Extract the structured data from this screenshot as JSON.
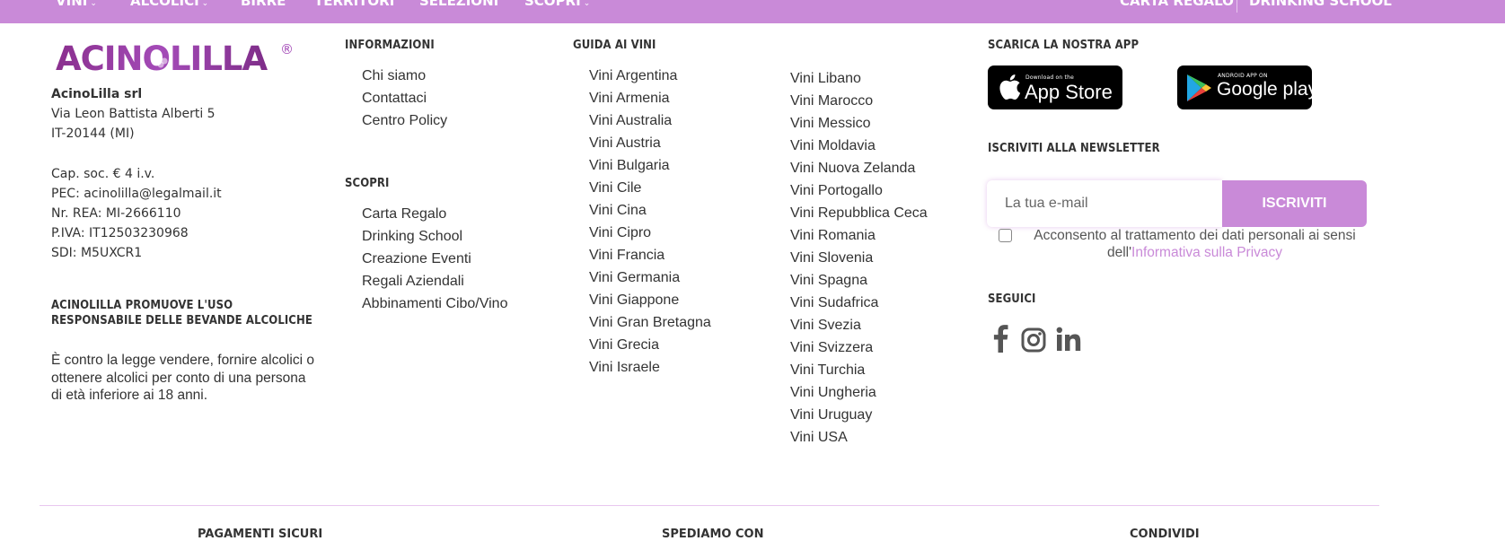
{
  "nav": {
    "left": [
      {
        "label": "VINI",
        "dropdown": true
      },
      {
        "label": "ALCOLICI",
        "dropdown": true
      },
      {
        "label": "BIRRE",
        "dropdown": false
      },
      {
        "label": "TERRITORI",
        "dropdown": false
      },
      {
        "label": "SELEZIONI",
        "dropdown": false
      },
      {
        "label": "SCOPRI",
        "dropdown": true
      }
    ],
    "right": [
      "CARTA REGALO",
      "DRINKING SCHOOL"
    ]
  },
  "colors": {
    "brand": "#c98ad8",
    "text": "#333333"
  },
  "company": {
    "logo_text": "ACINOLILLA",
    "logo_mark": "®",
    "name": "AcinoLilla srl",
    "address_lines": [
      "Via Leon Battista Alberti 5",
      "IT-20144 (MI)"
    ],
    "legal_lines": [
      "Cap. soc. € 4 i.v.",
      "PEC: acinolilla@legalmail.it",
      "Nr. REA: MI-2666110",
      "P.IVA: IT12503230968",
      "SDI: M5UXCR1"
    ]
  },
  "promo": {
    "heading_lines": [
      "ACINOLILLA PROMUOVE L'USO",
      "RESPONSABILE DELLE BEVANDE ALCOLICHE"
    ],
    "body_lines": [
      "È contro la legge vendere, fornire alcolici o",
      "ottenere alcolici per conto di una persona",
      "di età inferiore ai 18 anni."
    ]
  },
  "info": {
    "heading": "INFORMAZIONI",
    "links": [
      "Chi siamo",
      "Contattaci",
      "Centro Policy"
    ]
  },
  "scopri": {
    "heading": "SCOPRI",
    "links": [
      "Carta Regalo",
      "Drinking School",
      "Creazione Eventi",
      "Regali Aziendali",
      "Abbinamenti Cibo/Vino"
    ]
  },
  "guide": {
    "heading": "GUIDA AI VINI",
    "col1": [
      "Vini Argentina",
      "Vini Armenia",
      "Vini Australia",
      "Vini Austria",
      "Vini Bulgaria",
      "Vini Cile",
      "Vini Cina",
      "Vini Cipro",
      "Vini Francia",
      "Vini Germania",
      "Vini Giappone",
      "Vini Gran Bretagna",
      "Vini Grecia",
      "Vini Israele"
    ],
    "col2": [
      "Vini Libano",
      "Vini Marocco",
      "Vini Messico",
      "Vini Moldavia",
      "Vini Nuova Zelanda",
      "Vini Portogallo",
      "Vini Repubblica Ceca",
      "Vini Romania",
      "Vini Slovenia",
      "Vini Spagna",
      "Vini Sudafrica",
      "Vini Svezia",
      "Vini Svizzera",
      "Vini Turchia",
      "Vini Ungheria",
      "Vini Uruguay",
      "Vini USA"
    ]
  },
  "app": {
    "heading": "SCARICA LA NOSTRA APP",
    "appstore_small": "Download on the",
    "appstore_big": "App Store",
    "googleplay_small": "ANDROID APP ON",
    "googleplay_big": "Google play"
  },
  "newsletter": {
    "heading": "ISCRIVITI ALLA NEWSLETTER",
    "email_placeholder": "La tua e-mail",
    "button": "ISCRIVITI",
    "consent_text": "Acconsento al trattamento dei dati personali ai sensi dell'",
    "consent_link": "Informativa sulla Privacy"
  },
  "social": {
    "heading": "SEGUICI",
    "icons": [
      "facebook-icon",
      "instagram-icon",
      "linkedin-icon"
    ]
  },
  "bottom": [
    "PAGAMENTI SICURI",
    "SPEDIAMO CON",
    "CONDIVIDI"
  ]
}
